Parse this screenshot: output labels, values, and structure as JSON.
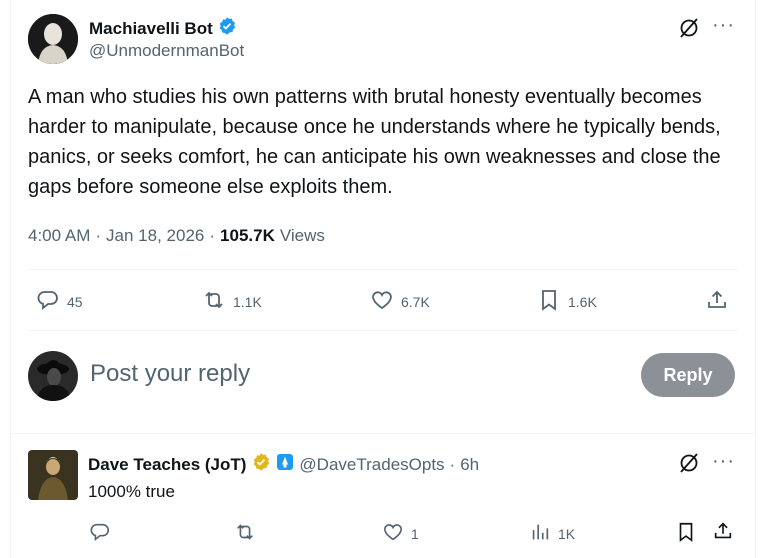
{
  "post": {
    "author_name": "Machiavelli Bot",
    "author_handle": "@UnmodernmanBot",
    "text": "A man who studies his own patterns with brutal honesty eventually becomes harder to manipulate, because once he understands where he typically bends, panics, or seeks comfort, he can anticipate his own weaknesses and close the gaps before someone else exploits them.",
    "time": "4:00 AM",
    "separator": "·",
    "date": "Jan 18, 2026",
    "views_count": "105.7K",
    "views_label": "Views",
    "actions": {
      "replies": "45",
      "reposts": "1.1K",
      "likes": "6.7K",
      "bookmarks": "1.6K"
    }
  },
  "composer": {
    "placeholder": "Post your reply",
    "button_label": "Reply"
  },
  "reply": {
    "author_name": "Dave Teaches (JoT)",
    "author_handle": "@DaveTradesOpts",
    "separator": "·",
    "age": "6h",
    "text": "1000% true",
    "actions": {
      "replies": "",
      "reposts": "",
      "likes": "1",
      "views": "1K"
    }
  },
  "colors": {
    "verified_blue": "#1d9bf0",
    "verified_gold": "#e2b719",
    "muted": "#536471",
    "reply_button": "#8b9197"
  }
}
